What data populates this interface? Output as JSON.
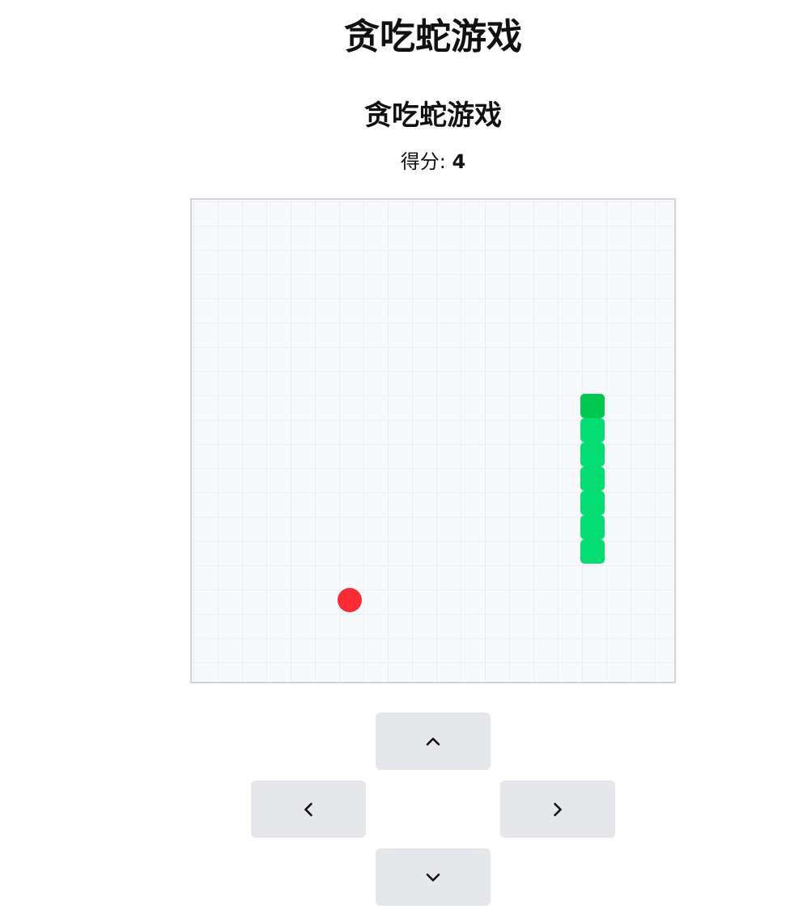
{
  "page": {
    "title": "贪吃蛇游戏"
  },
  "game": {
    "title": "贪吃蛇游戏",
    "score_label": "得分: ",
    "score": "4",
    "grid_size": 20,
    "snake": [
      {
        "col": 16,
        "row": 8
      },
      {
        "col": 16,
        "row": 9
      },
      {
        "col": 16,
        "row": 10
      },
      {
        "col": 16,
        "row": 11
      },
      {
        "col": 16,
        "row": 12
      },
      {
        "col": 16,
        "row": 13
      },
      {
        "col": 16,
        "row": 14
      }
    ],
    "food": {
      "col": 6,
      "row": 16
    },
    "colors": {
      "snake_head": "#00c851",
      "snake_body": "#05dd72",
      "food": "#fb2c36",
      "board_bg": "#f8f9fb",
      "button_bg": "#e5e7eb"
    }
  },
  "controls": {
    "up_icon": "chevron-up-icon",
    "left_icon": "chevron-left-icon",
    "right_icon": "chevron-right-icon",
    "down_icon": "chevron-down-icon"
  }
}
